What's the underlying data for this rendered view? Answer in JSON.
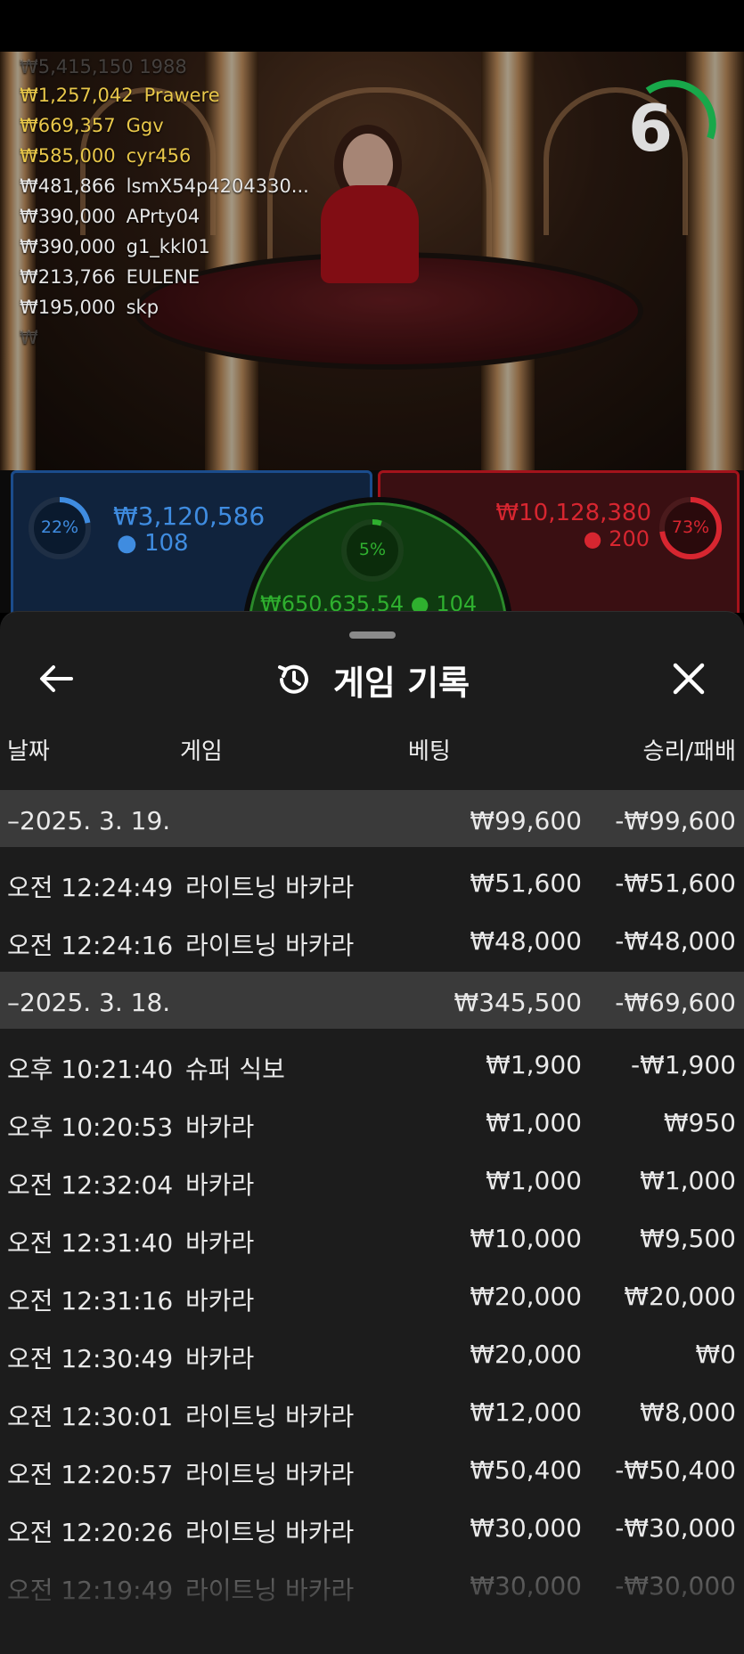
{
  "leaderboard": {
    "top_faded": "₩5,415,150 1988",
    "rows": [
      {
        "amount": "₩1,257,042",
        "name": "Prawere",
        "tone": "gold"
      },
      {
        "amount": "₩669,357",
        "name": "Ggv",
        "tone": "gold"
      },
      {
        "amount": "₩585,000",
        "name": "cyr456",
        "tone": "gold"
      },
      {
        "amount": "₩481,866",
        "name": "lsmX54p4204330...",
        "tone": "white"
      },
      {
        "amount": "₩390,000",
        "name": "APrty04",
        "tone": "white"
      },
      {
        "amount": "₩390,000",
        "name": "g1_kkl01",
        "tone": "white"
      },
      {
        "amount": "₩213,766",
        "name": "EULENE",
        "tone": "white"
      },
      {
        "amount": "₩195,000",
        "name": "skp",
        "tone": "white"
      }
    ]
  },
  "timer": {
    "value": "6",
    "color": "#18a84a"
  },
  "bets": {
    "player": {
      "percent": "22%",
      "percent_value": 22,
      "amount": "₩3,120,586",
      "players": "108",
      "color": "#3f8ce0"
    },
    "banker": {
      "percent": "73%",
      "percent_value": 73,
      "amount": "₩10,128,380",
      "players": "200",
      "color": "#d72630"
    },
    "tie": {
      "percent": "5%",
      "percent_value": 5,
      "amount": "₩650,635.54",
      "players": "104",
      "color": "#2fb02f"
    }
  },
  "history": {
    "title": "게임 기록",
    "columns": {
      "date": "날짜",
      "game": "게임",
      "bet": "베팅",
      "result": "승리/패배"
    },
    "groups": [
      {
        "date": "–2025. 3. 19.",
        "bet_total": "₩99,600",
        "result_total": "-₩99,600",
        "items": [
          {
            "time": "오전 12:24:49",
            "game": "라이트닝 바카라",
            "bet": "₩51,600",
            "result": "-₩51,600"
          },
          {
            "time": "오전 12:24:16",
            "game": "라이트닝 바카라",
            "bet": "₩48,000",
            "result": "-₩48,000"
          }
        ]
      },
      {
        "date": "–2025. 3. 18.",
        "bet_total": "₩345,500",
        "result_total": "-₩69,600",
        "items": [
          {
            "time": "오후 10:21:40",
            "game": "슈퍼 식보",
            "bet": "₩1,900",
            "result": "-₩1,900"
          },
          {
            "time": "오후 10:20:53",
            "game": "바카라",
            "bet": "₩1,000",
            "result": "₩950"
          },
          {
            "time": "오전 12:32:04",
            "game": "바카라",
            "bet": "₩1,000",
            "result": "₩1,000"
          },
          {
            "time": "오전 12:31:40",
            "game": "바카라",
            "bet": "₩10,000",
            "result": "₩9,500"
          },
          {
            "time": "오전 12:31:16",
            "game": "바카라",
            "bet": "₩20,000",
            "result": "₩20,000"
          },
          {
            "time": "오전 12:30:49",
            "game": "바카라",
            "bet": "₩20,000",
            "result": "₩0"
          },
          {
            "time": "오전 12:30:01",
            "game": "라이트닝 바카라",
            "bet": "₩12,000",
            "result": "₩8,000"
          },
          {
            "time": "오전 12:20:57",
            "game": "라이트닝 바카라",
            "bet": "₩50,400",
            "result": "-₩50,400"
          },
          {
            "time": "오전 12:20:26",
            "game": "라이트닝 바카라",
            "bet": "₩30,000",
            "result": "-₩30,000"
          },
          {
            "time": "오전 12:19:49",
            "game": "라이트닝 바카라",
            "bet": "₩30,000",
            "result": "-₩30,000"
          }
        ]
      }
    ]
  },
  "icons": {
    "back": "arrow-left-icon",
    "history": "history-icon",
    "close": "close-icon",
    "player": "user-icon"
  }
}
